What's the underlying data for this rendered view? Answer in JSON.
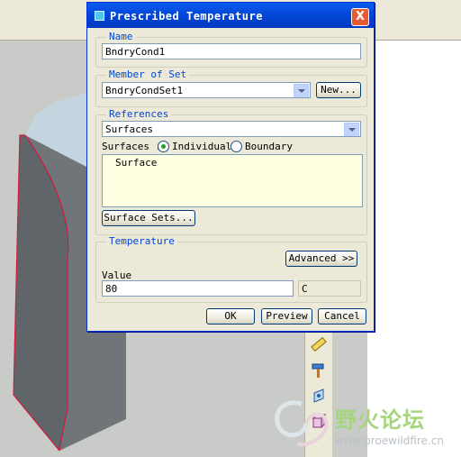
{
  "dialog": {
    "title": "Prescribed Temperature",
    "close_symbol": "X",
    "name_group": {
      "label": "Name",
      "value": "BndryCond1"
    },
    "member_group": {
      "label": "Member of Set",
      "selected": "BndryCondSet1",
      "new_button": "New..."
    },
    "references_group": {
      "label": "References",
      "type_selected": "Surfaces",
      "mode_label": "Surfaces :",
      "radio_individual": "Individual",
      "radio_boundary": "Boundary",
      "selected_radio": "Individual",
      "list_items": [
        "Surface"
      ],
      "surface_sets_button": "Surface Sets..."
    },
    "temperature_group": {
      "label": "Temperature",
      "advanced_button": "Advanced >>",
      "value_label": "Value",
      "value": "80",
      "unit": "C"
    },
    "buttons": {
      "ok": "OK",
      "preview": "Preview",
      "cancel": "Cancel"
    }
  },
  "watermark": {
    "text": "野火论坛",
    "url": "www.proewildfire.cn"
  },
  "icons": [
    "ruler-icon",
    "hammer-icon",
    "sketch-tool-icon",
    "cube-tool-icon",
    "title-app-icon",
    "close-icon"
  ]
}
